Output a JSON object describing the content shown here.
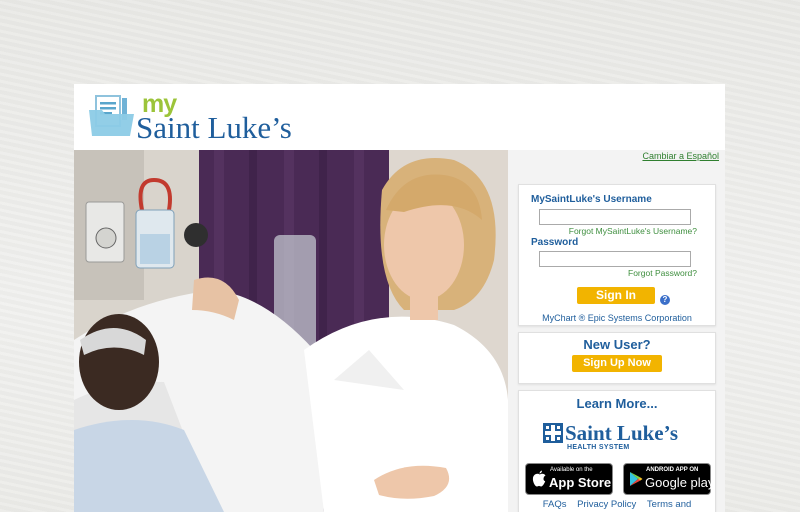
{
  "brand": {
    "logo_my": "my",
    "logo_name": "Saint Luke’s"
  },
  "side": {
    "lang_link": "Cambiar a Español"
  },
  "login": {
    "username_label": "MySaintLuke's Username",
    "username_value": "",
    "forgot_username": "Forgot MySaintLuke's Username?",
    "password_label": "Password",
    "password_value": "",
    "forgot_password": "Forgot Password?",
    "signin_label": "Sign In",
    "help_glyph": "?",
    "credit": "MyChart ® Epic Systems Corporation"
  },
  "newuser": {
    "title": "New User?",
    "signup_label": "Sign Up Now"
  },
  "learn": {
    "title": "Learn More...",
    "hs_name": "Saint Luke’s",
    "hs_sub": "HEALTH SYSTEM",
    "appstore_small": "Available on the",
    "appstore_big": "App Store",
    "googleplay_small": "ANDROID APP ON",
    "googleplay_big": "Google play"
  },
  "footer": {
    "faqs": "FAQs",
    "privacy": "Privacy Policy",
    "terms": "Terms and"
  },
  "colors": {
    "brand_blue": "#1f5e9c",
    "brand_green": "#9cc43a",
    "signin_yellow": "#f2b400",
    "link_green": "#3f8f3f"
  }
}
